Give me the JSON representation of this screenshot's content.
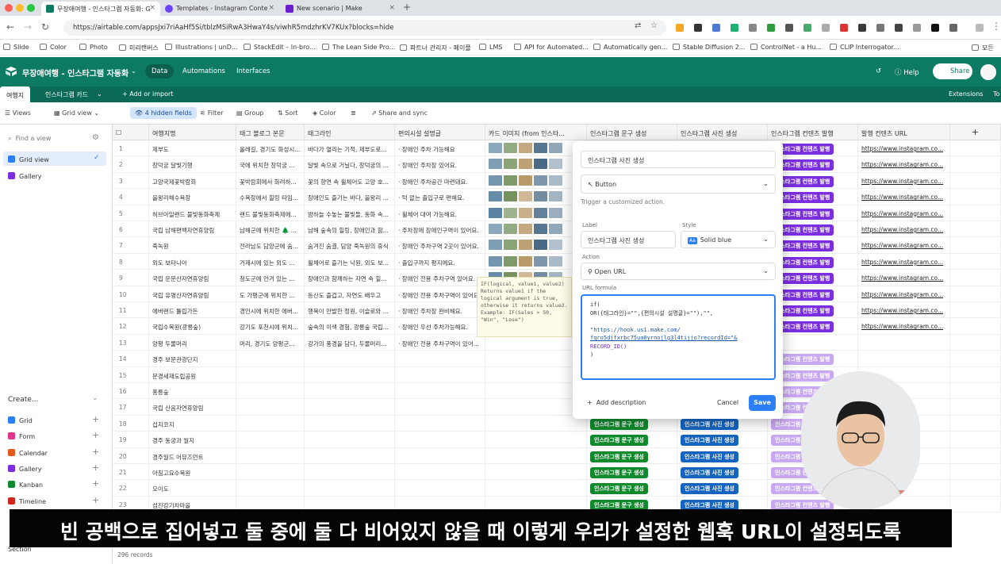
{
  "browser": {
    "tabs": [
      {
        "title": "무장애여행 - 인스타그램 자동화: G",
        "active": true,
        "color": "#0d7a63"
      },
      {
        "title": "Templates - Instagram Conte",
        "active": false,
        "color": "#6e44ff"
      },
      {
        "title": "New scenario | Make",
        "active": false,
        "color": "#6b1fd1"
      }
    ],
    "url": "https://airtable.com/appsJxi7riAaHf5Si/tblzMSiRwA3HwaY4s/viwhR5mdzhrKV7KUx?blocks=hide",
    "bookmarks": [
      "Slide",
      "Color",
      "Photo",
      "미리캔버스",
      "Illustrations | unD...",
      "StackEdit – In-bro...",
      "The Lean Side Pro...",
      "파트너 관리자 - 페이플",
      "LMS",
      "API for Automated...",
      "Automatically gen...",
      "Stable Diffusion 2...",
      "ControlNet - a Hu...",
      "CLIP Interrogator...",
      "모든"
    ]
  },
  "app": {
    "base_name": "무장애여행 - 인스타그램 자동화",
    "nav": [
      "Data",
      "Automations",
      "Interfaces"
    ],
    "help": "Help",
    "share": "Share",
    "tables": [
      "여행지",
      "인스타그램 카드"
    ],
    "add_import": "+ Add or import",
    "extensions": "Extensions",
    "tools": "To"
  },
  "viewbar": {
    "views": "Views",
    "grid_view": "Grid view",
    "hidden": "4 hidden fields",
    "filter": "Filter",
    "group": "Group",
    "sort": "Sort",
    "color": "Color",
    "share_sync": "Share and sync"
  },
  "sidebar": {
    "find": "Find a view",
    "views": [
      "Grid view",
      "Gallery"
    ],
    "create": "Create...",
    "create_items": [
      "Grid",
      "Form",
      "Calendar",
      "Gallery",
      "Kanban",
      "Timeline"
    ],
    "section": "Section"
  },
  "grid": {
    "columns": [
      "여행지명",
      "태그 블로그 본문",
      "태그라인",
      "편의시설 설명글",
      "카드 이미지 (from 인스타...",
      "인스타그램 문구 생성",
      "인스타그램 사진 생성",
      "인스타그램 컨텐츠 발행",
      "발행 컨텐츠 URL"
    ],
    "rows": [
      {
        "n": "1",
        "name": "제부도",
        "c2": "올레길, 경기도 화성시...",
        "c3": "바다가 열리는 기적, 제부도로...",
        "c4": "장애인 주차 가능해요"
      },
      {
        "n": "2",
        "name": "창덕궁 달빛기행",
        "c2": "국에 위치한 창덕궁 ...",
        "c3": "달빛 속으로 거닐다, 창덕궁의 ...",
        "c4": "장애인 주차장 있어요."
      },
      {
        "n": "3",
        "name": "고양국제꽃박람회",
        "c2": "꽃박람회에서 화려하...",
        "c3": "꽃의 향연 속 휠체어도 고양 호...",
        "c4": "장애인 주차공간 마련돼요."
      },
      {
        "n": "4",
        "name": "을왕리해수욕장",
        "c2": "수욕장에서 힐링 타임...",
        "c3": "장애인도 즐기는 바다, 을왕리 ...",
        "c4": "턱 없는 출입구로 편해요."
      },
      {
        "n": "5",
        "name": "허브아일랜드 불빛동화축제",
        "c2": "랜드 불빛동화축제에...",
        "c3": "밤하늘 수놓는 불빛들, 동화 속...",
        "c4": "휠체어 대여 가능해요."
      },
      {
        "n": "6",
        "name": "국립 남해편백자연휴양림",
        "c2": "남해군에 위치한 🌲 ...",
        "c3": "남해 숲속의 힐링, 장애인과 함...",
        "c4": "주차장에 장애인구역이 있어요."
      },
      {
        "n": "7",
        "name": "죽녹원",
        "c2": "전라남도 담양군에 숨...",
        "c3": "숨겨진 숨결, 담양 죽녹원의 휴식",
        "c4": "장애인 주차구역 2곳이 있어요."
      },
      {
        "n": "8",
        "name": "외도 보타니아",
        "c2": "거제시에 있는 외도 ...",
        "c3": "휠체어로 즐기는 낙원, 외도 보...",
        "c4": "출입구까지 평지에요."
      },
      {
        "n": "9",
        "name": "국립 운문산자연휴양림",
        "c2": "청도군에 안겨 있는 ...",
        "c3": "장애인과 함께하는 자연 속 힐...",
        "c4": "장애인 전용 주차구역 있어요."
      },
      {
        "n": "10",
        "name": "국립 유명산자연휴양림",
        "c2": "도 가평군에 위치한 ...",
        "c3": "등산도 즐겁고, 자연도 배우고",
        "c4": "장애인 전용 주차구역이 있어요."
      },
      {
        "n": "11",
        "name": "에버랜드 튤립가든",
        "c2": "경인시에 위치한 에버...",
        "c3": "행복이 만발한 정원, 이슬로와 ...",
        "c4": "장애인 주차장 완비해요."
      },
      {
        "n": "12",
        "name": "국립수목원(광릉숲)",
        "c2": "강기도 포천시에 위치...",
        "c3": "숲속의 이색 경험, 광릉숲 국립...",
        "c4": "장애인 우선 주차가능해요."
      },
      {
        "n": "13",
        "name": "양평 두물머리",
        "c2": "머리, 경기도 양평군...",
        "c3": "강가의 풍경을 담다, 두물머리...",
        "c4": "장애인 전용 주차구역이 있어..."
      },
      {
        "n": "14",
        "name": "경주 보문관광단지",
        "c2": "",
        "c3": "",
        "c4": ""
      },
      {
        "n": "15",
        "name": "문경새재도립공원",
        "c2": "",
        "c3": "",
        "c4": ""
      },
      {
        "n": "16",
        "name": "홍릉숲",
        "c2": "",
        "c3": "",
        "c4": ""
      },
      {
        "n": "17",
        "name": "국립 산음자연휴양림",
        "c2": "",
        "c3": "",
        "c4": ""
      },
      {
        "n": "18",
        "name": "섭지코지",
        "c2": "",
        "c3": "",
        "c4": ""
      },
      {
        "n": "19",
        "name": "경주 동궁과 월지",
        "c2": "",
        "c3": "",
        "c4": ""
      },
      {
        "n": "20",
        "name": "경주월드 어뮤즈먼트",
        "c2": "",
        "c3": "",
        "c4": ""
      },
      {
        "n": "21",
        "name": "아침고요수목원",
        "c2": "",
        "c3": "",
        "c4": ""
      },
      {
        "n": "22",
        "name": "오이도",
        "c2": "",
        "c3": "",
        "c4": ""
      },
      {
        "n": "23",
        "name": "섬진강기차마을",
        "c2": "",
        "c3": "",
        "c4": ""
      }
    ],
    "btn_text": "인스타그램 문구 생성",
    "btn_photo": "인스타그램 사진 생성",
    "btn_publish": "인스타그램 컨텐츠 발행",
    "url_text": "https://www.instagram.co...",
    "records": "296 records"
  },
  "popup": {
    "field_name": "인스타그램 사진 생성",
    "type": "Button",
    "desc": "Trigger a customized action.",
    "label_label": "Label",
    "label_value": "인스타그램 사진 생성",
    "style_label": "Style",
    "style_value": "Solid blue",
    "action_label": "Action",
    "action_value": "Open URL",
    "formula_label": "URL formula",
    "formula_lines": [
      "if(",
      "OR({태그라인}=\"\",{편의시설 설명글}=\"\"),\"\",",
      "",
      "\"https://hook.us1.make.com/",
      "fqro5djfxrbc75ua0yrnojlg3l4tijjo?recordId=\"&",
      "RECORD_ID()",
      ")"
    ],
    "add_desc": "Add description",
    "cancel": "Cancel",
    "save": "Save"
  },
  "tooltip": "IF(logical, value1, value2) Returns value1 if the logical argument is true, otherwise it returns value2. Example: IF(Sales > 50, \"Win\", \"Lose\")",
  "subtitle": "빈 공백으로 집어넣고 둘 중에 둘 다 비어있지 않을 때 이렇게 우리가 설정한 웹훅 URL이 설정되도록",
  "colors": {
    "brand": "#0d7a63",
    "pill_green": "#118a2e",
    "pill_blue": "#1565c0",
    "pill_purple": "#7b2ee0",
    "accent": "#2d7ff9"
  }
}
